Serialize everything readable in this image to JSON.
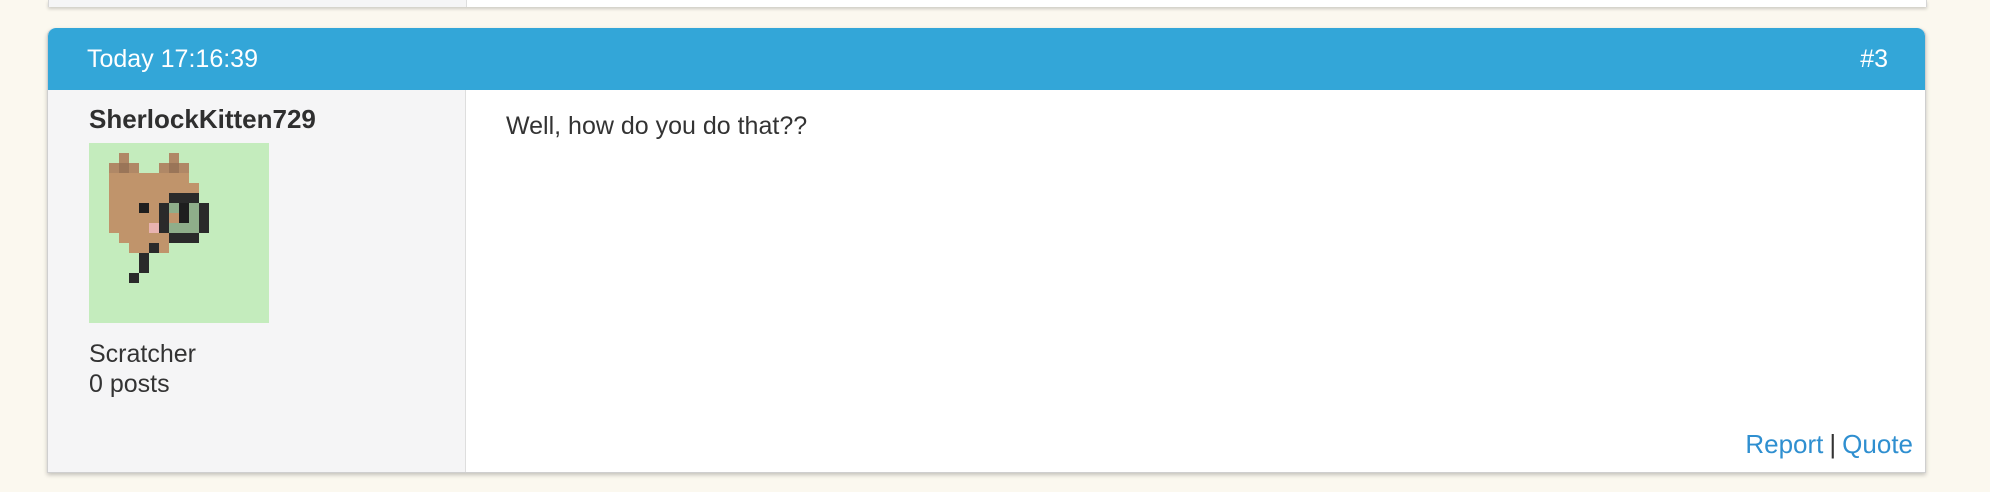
{
  "post": {
    "timestamp": "Today 17:16:39",
    "number": "#3",
    "author": {
      "username": "SherlockKitten729",
      "rank": "Scratcher",
      "post_count": "0 posts"
    },
    "content": "Well, how do you do that??",
    "actions": {
      "report_label": "Report",
      "separator": "|",
      "quote_label": "Quote"
    }
  },
  "colors": {
    "header_bg": "#33a6d8",
    "link": "#2f8fd0",
    "sidebar_bg": "#f5f5f6",
    "avatar_bg": "#c4ecbd",
    "page_bg": "#fbf8ef"
  },
  "avatar_description_icon": "cat-with-magnifying-glass-icon"
}
